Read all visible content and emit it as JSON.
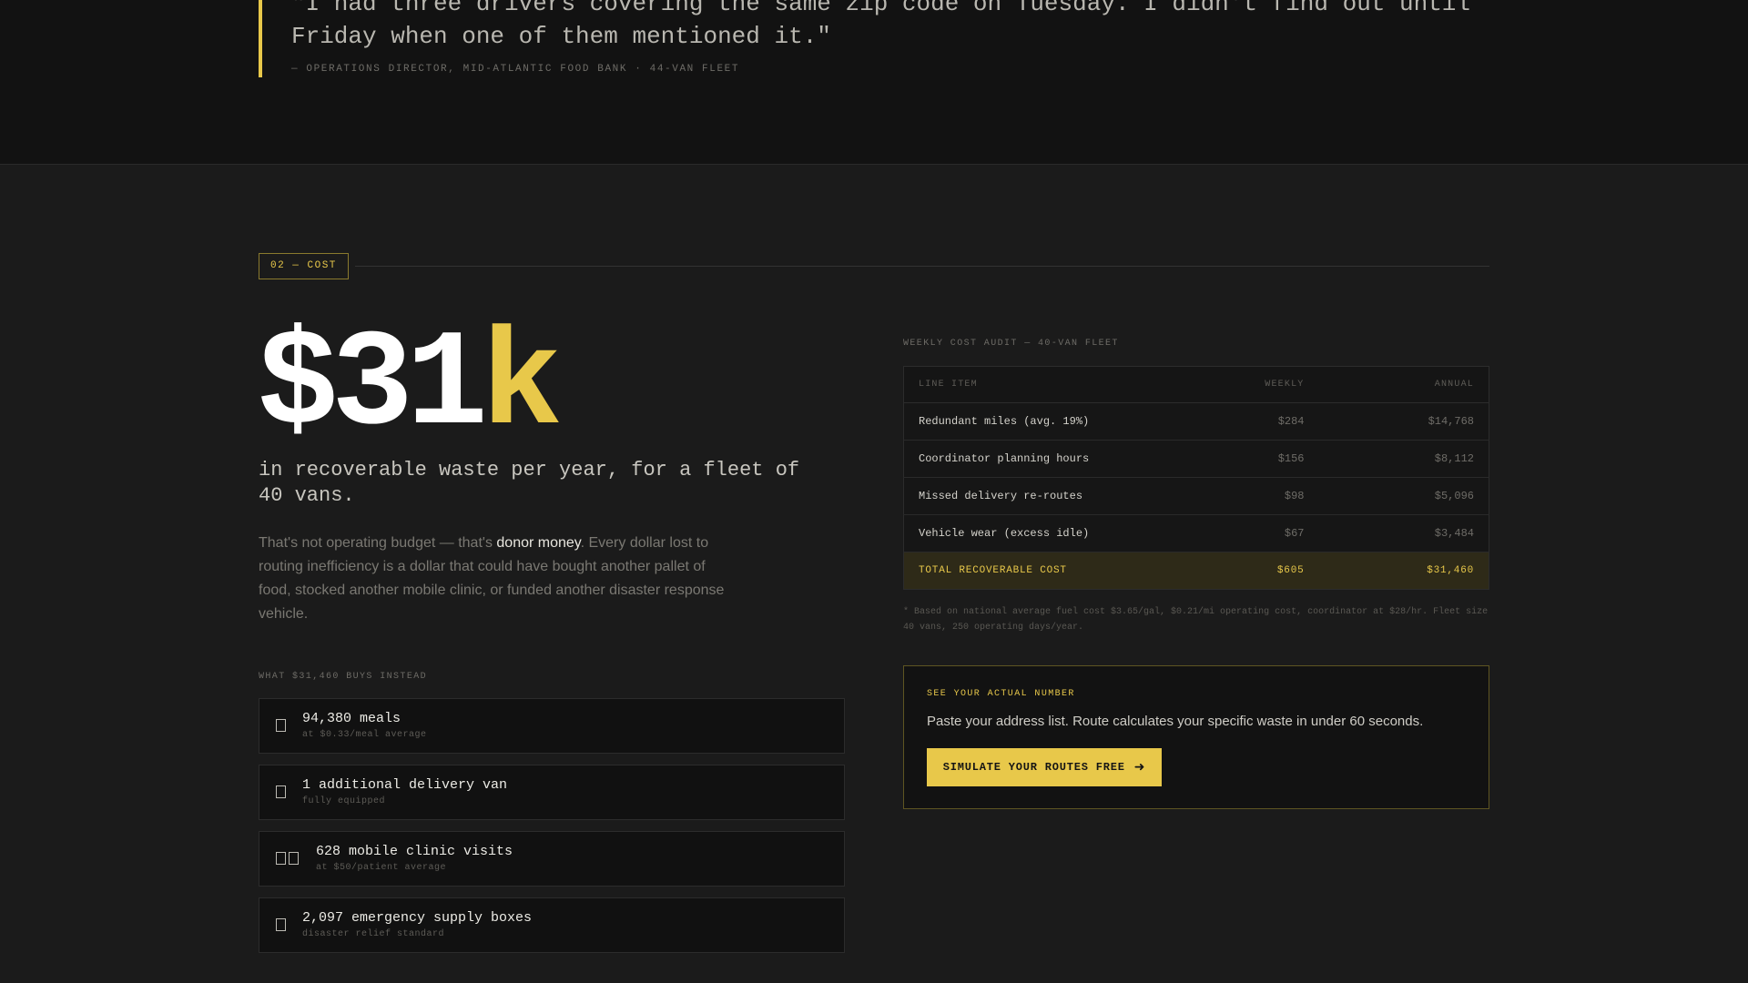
{
  "quote": {
    "text": "\"I had three drivers covering the same zip code on Tuesday. I didn't find out until Friday when one of them mentioned it.\"",
    "attribution": "— OPERATIONS DIRECTOR, MID-ATLANTIC FOOD BANK · 44-VAN FLEET",
    "accent_color": "#e8c84a"
  },
  "section": {
    "tag": "02 — COST"
  },
  "headline": {
    "amount": "$31",
    "suffix": "k",
    "subtitle": "in recoverable waste per year, for a fleet of 40 vans."
  },
  "body": {
    "lead": "That's not operating budget — that's ",
    "highlight": "donor money",
    "rest": ". Every dollar lost to routing inefficiency is a dollar that could have bought another pallet of food, stocked another mobile clinic, or funded another disaster response vehicle."
  },
  "buys": {
    "label": "WHAT $31,460 BUYS INSTEAD",
    "items": [
      {
        "icon": "meal-icon",
        "title": "94,380 meals",
        "subtitle": "at $0.33/meal average"
      },
      {
        "icon": "van-icon",
        "title": "1 additional delivery van",
        "subtitle": "fully equipped"
      },
      {
        "icon": "clinic-icon",
        "title": "628 mobile clinic visits",
        "subtitle": "at $50/patient average"
      },
      {
        "icon": "supply-box-icon",
        "title": "2,097 emergency supply boxes",
        "subtitle": "disaster relief standard"
      }
    ]
  },
  "audit": {
    "label": "WEEKLY COST AUDIT — 40-VAN FLEET",
    "columns": [
      "LINE ITEM",
      "WEEKLY",
      "ANNUAL"
    ],
    "rows": [
      {
        "item": "Redundant miles (avg. 19%)",
        "weekly": "$284",
        "annual": "$14,768"
      },
      {
        "item": "Coordinator planning hours",
        "weekly": "$156",
        "annual": "$8,112"
      },
      {
        "item": "Missed delivery re-routes",
        "weekly": "$98",
        "annual": "$5,096"
      },
      {
        "item": "Vehicle wear (excess idle)",
        "weekly": "$67",
        "annual": "$3,484"
      }
    ],
    "total": {
      "item": "TOTAL RECOVERABLE COST",
      "weekly": "$605",
      "annual": "$31,460"
    },
    "note": "* Based on national average fuel cost $3.65/gal, $0.21/mi operating cost, coordinator at $28/hr. Fleet size 40 vans, 250 operating days/year."
  },
  "cta": {
    "eyebrow": "SEE YOUR ACTUAL NUMBER",
    "text": "Paste your address list. Route calculates your specific waste in under 60 seconds.",
    "button": "SIMULATE YOUR ROUTES FREE",
    "button_icon": "arrow-right-icon"
  }
}
